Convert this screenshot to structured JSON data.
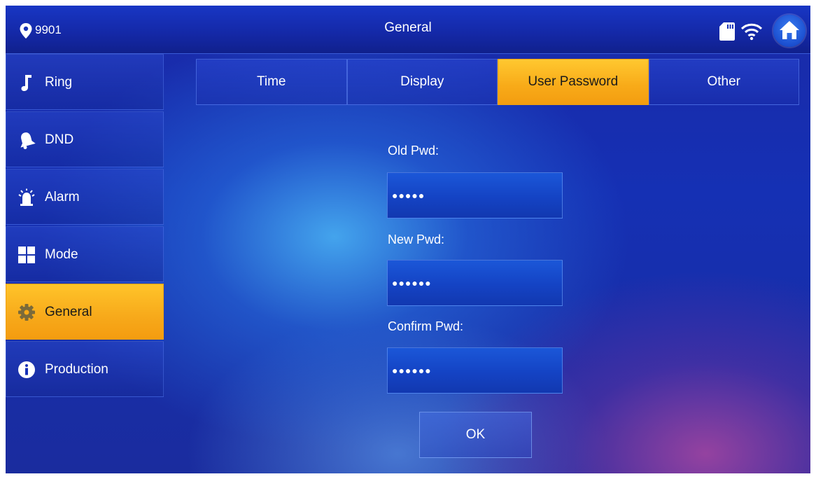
{
  "header": {
    "room_number": "9901",
    "title": "General",
    "icons": [
      "location-pin-icon",
      "sd-card-icon",
      "wifi-icon",
      "home-icon"
    ]
  },
  "sidebar": {
    "items": [
      {
        "label": "Ring",
        "icon": "music-note-icon",
        "active": false
      },
      {
        "label": "DND",
        "icon": "bell-icon",
        "active": false
      },
      {
        "label": "Alarm",
        "icon": "alarm-siren-icon",
        "active": false
      },
      {
        "label": "Mode",
        "icon": "grid-icon",
        "active": false
      },
      {
        "label": "General",
        "icon": "gear-icon",
        "active": true
      },
      {
        "label": "Production",
        "icon": "info-icon",
        "active": false
      }
    ]
  },
  "tabs": [
    {
      "label": "Time",
      "active": false
    },
    {
      "label": "Display",
      "active": false
    },
    {
      "label": "User Password",
      "active": true
    },
    {
      "label": "Other",
      "active": false
    }
  ],
  "form": {
    "old_pwd_label": "Old Pwd:",
    "old_pwd_value": "●●●●●",
    "new_pwd_label": "New Pwd:",
    "new_pwd_value": "●●●●●●",
    "confirm_pwd_label": "Confirm Pwd:",
    "confirm_pwd_value": "●●●●●●",
    "ok_label": "OK"
  },
  "colors": {
    "accent": "#f8aa18",
    "background": "#1a2aa8",
    "text": "#ffffff"
  }
}
